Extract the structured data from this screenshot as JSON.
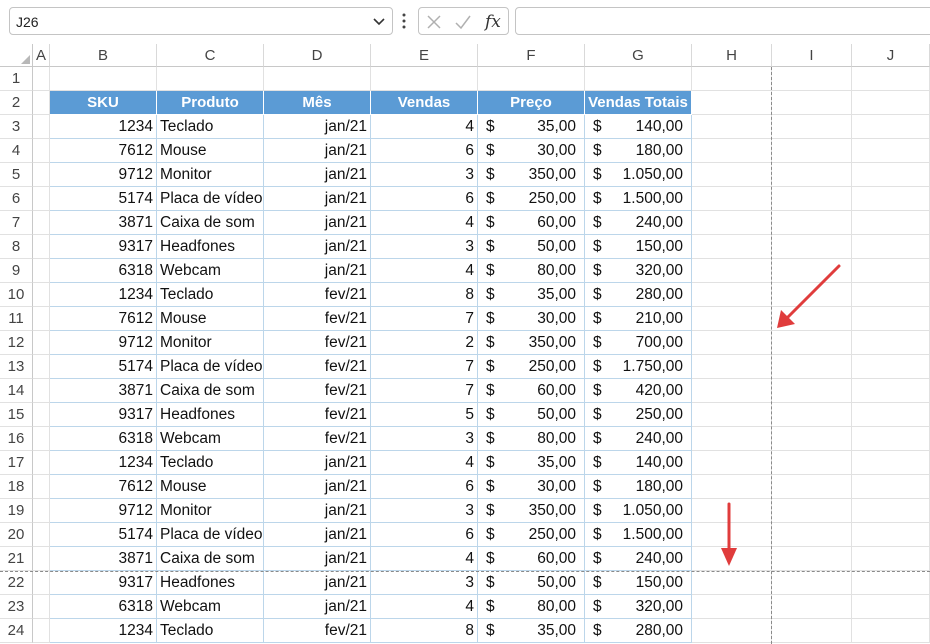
{
  "formula_bar": {
    "name_box": "J26",
    "formula": "",
    "fx_label": "fx"
  },
  "columns": [
    "A",
    "B",
    "C",
    "D",
    "E",
    "F",
    "G",
    "H",
    "I",
    "J"
  ],
  "rows": [
    "1",
    "2",
    "3",
    "4",
    "5",
    "6",
    "7",
    "8",
    "9",
    "10",
    "11",
    "12",
    "13",
    "14",
    "15",
    "16",
    "17",
    "18",
    "19",
    "20",
    "21",
    "22",
    "23",
    "24"
  ],
  "table": {
    "headers": [
      "SKU",
      "Produto",
      "Mês",
      "Vendas",
      "Preço",
      "Vendas Totais"
    ],
    "currency_symbol": "$",
    "rows": [
      [
        "1234",
        "Teclado",
        "jan/21",
        "4",
        "35,00",
        "140,00"
      ],
      [
        "7612",
        "Mouse",
        "jan/21",
        "6",
        "30,00",
        "180,00"
      ],
      [
        "9712",
        "Monitor",
        "jan/21",
        "3",
        "350,00",
        "1.050,00"
      ],
      [
        "5174",
        "Placa de vídeo",
        "jan/21",
        "6",
        "250,00",
        "1.500,00"
      ],
      [
        "3871",
        "Caixa de som",
        "jan/21",
        "4",
        "60,00",
        "240,00"
      ],
      [
        "9317",
        "Headfones",
        "jan/21",
        "3",
        "50,00",
        "150,00"
      ],
      [
        "6318",
        "Webcam",
        "jan/21",
        "4",
        "80,00",
        "320,00"
      ],
      [
        "1234",
        "Teclado",
        "fev/21",
        "8",
        "35,00",
        "280,00"
      ],
      [
        "7612",
        "Mouse",
        "fev/21",
        "7",
        "30,00",
        "210,00"
      ],
      [
        "9712",
        "Monitor",
        "fev/21",
        "2",
        "350,00",
        "700,00"
      ],
      [
        "5174",
        "Placa de vídeo",
        "fev/21",
        "7",
        "250,00",
        "1.750,00"
      ],
      [
        "3871",
        "Caixa de som",
        "fev/21",
        "7",
        "60,00",
        "420,00"
      ],
      [
        "9317",
        "Headfones",
        "fev/21",
        "5",
        "50,00",
        "250,00"
      ],
      [
        "6318",
        "Webcam",
        "fev/21",
        "3",
        "80,00",
        "240,00"
      ],
      [
        "1234",
        "Teclado",
        "jan/21",
        "4",
        "35,00",
        "140,00"
      ],
      [
        "7612",
        "Mouse",
        "jan/21",
        "6",
        "30,00",
        "180,00"
      ],
      [
        "9712",
        "Monitor",
        "jan/21",
        "3",
        "350,00",
        "1.050,00"
      ],
      [
        "5174",
        "Placa de vídeo",
        "jan/21",
        "6",
        "250,00",
        "1.500,00"
      ],
      [
        "3871",
        "Caixa de som",
        "jan/21",
        "4",
        "60,00",
        "240,00"
      ],
      [
        "9317",
        "Headfones",
        "jan/21",
        "3",
        "50,00",
        "150,00"
      ],
      [
        "6318",
        "Webcam",
        "jan/21",
        "4",
        "80,00",
        "320,00"
      ],
      [
        "1234",
        "Teclado",
        "fev/21",
        "8",
        "35,00",
        "280,00"
      ]
    ]
  },
  "colors": {
    "table_header_bg": "#5b9bd5",
    "table_header_text": "#ffffff",
    "arrow": "#e03c3c",
    "page_break": "#8a8a8a"
  },
  "icons": [
    "chevron-down-icon",
    "more-options-icon",
    "cancel-icon",
    "enter-icon",
    "function-icon",
    "arrow-annotation-icon"
  ]
}
